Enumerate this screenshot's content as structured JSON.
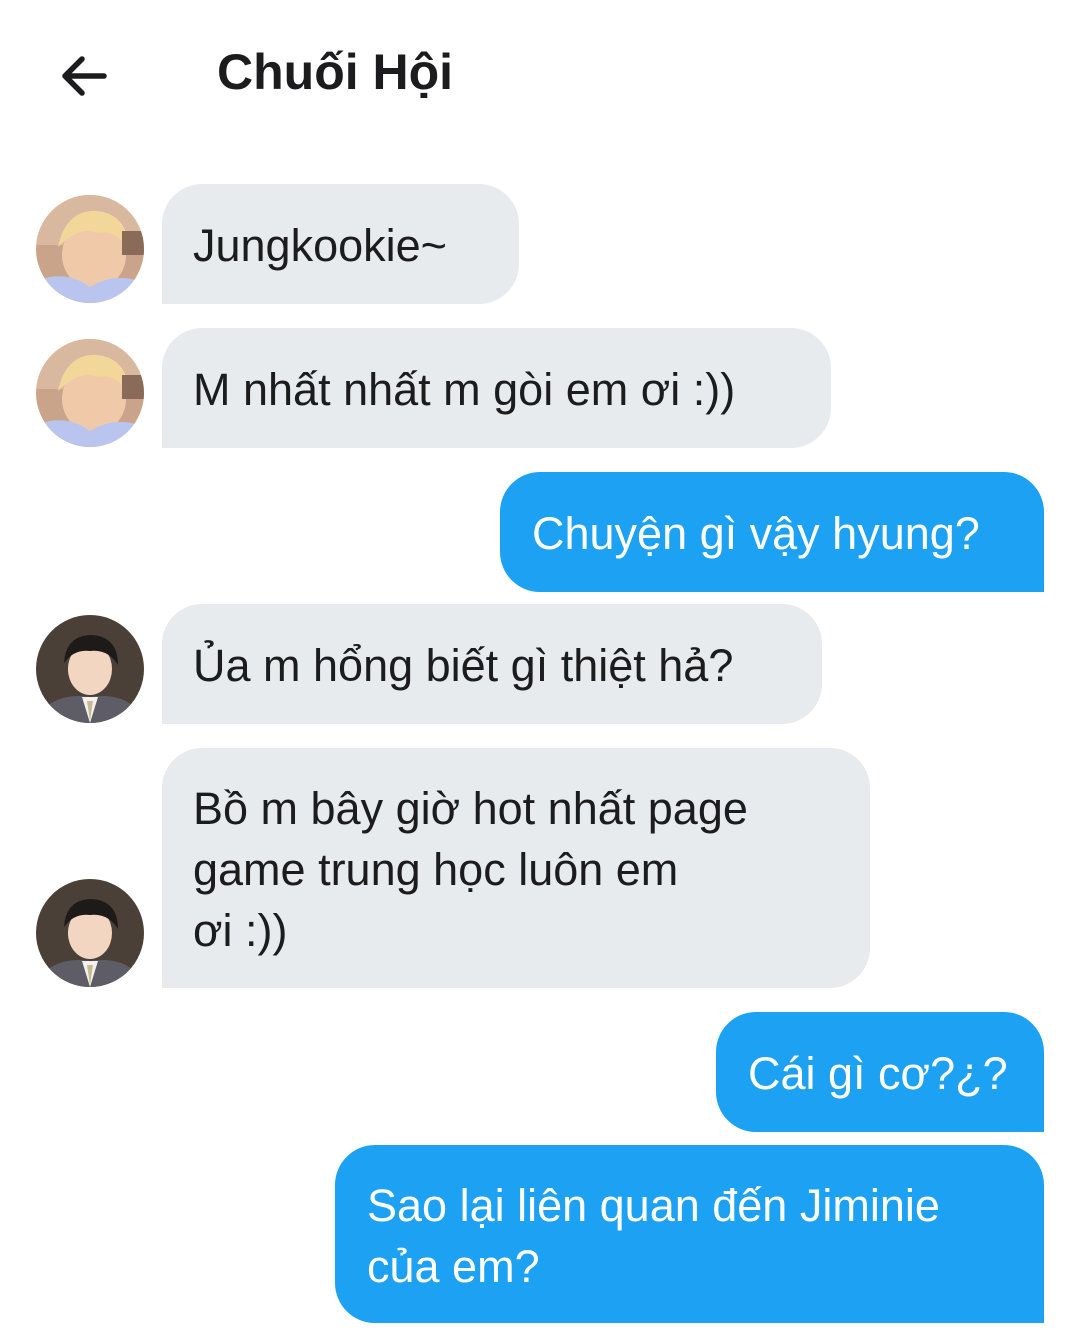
{
  "header": {
    "back_icon": "arrow-left-icon",
    "title": "Chuối Hội"
  },
  "colors": {
    "incoming_bubble": "#e8ebee",
    "outgoing_bubble": "#1da1f2",
    "incoming_text": "#1c1c1e",
    "outgoing_text": "#ffffff"
  },
  "messages": [
    {
      "direction": "incoming",
      "avatar": "blond-hair-avatar",
      "text": "Jungkookie~"
    },
    {
      "direction": "incoming",
      "avatar": "blond-hair-avatar",
      "text": "M nhất nhất m gòi em ơi :))"
    },
    {
      "direction": "outgoing",
      "text": "Chuyện gì vậy hyung?"
    },
    {
      "direction": "incoming",
      "avatar": "dark-hair-suit-avatar",
      "text": "Ủa m hổng biết gì thiệt hả?"
    },
    {
      "direction": "incoming",
      "avatar": "dark-hair-suit-avatar",
      "text": "Bồ m bây giờ hot nhất page\ngame trung học luôn em\nơi :))"
    },
    {
      "direction": "outgoing",
      "text": "Cái gì cơ?¿?"
    },
    {
      "direction": "outgoing",
      "text": "Sao lại liên quan đến Jiminie\ncủa em?"
    }
  ]
}
